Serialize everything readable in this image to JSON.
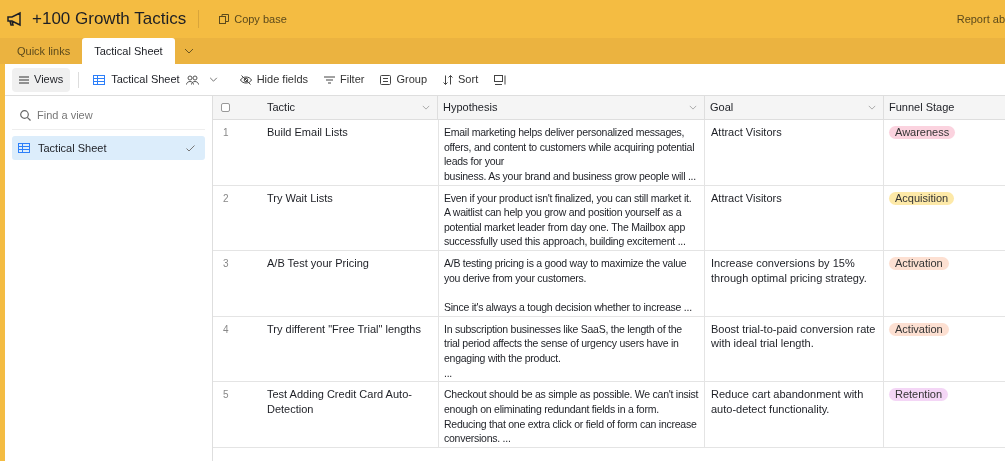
{
  "header": {
    "title": "+100 Growth Tactics",
    "copy_button": "Copy base",
    "report_link": "Report ab"
  },
  "tabs": [
    {
      "label": "Quick links",
      "selected": false
    },
    {
      "label": "Tactical Sheet",
      "selected": true
    }
  ],
  "toolbar": {
    "views_button": "Views",
    "view_name": "Tactical Sheet",
    "buttons": [
      {
        "kind": "hide",
        "label": "Hide fields"
      },
      {
        "kind": "filter",
        "label": "Filter"
      },
      {
        "kind": "group",
        "label": "Group"
      },
      {
        "kind": "sort",
        "label": "Sort"
      },
      {
        "kind": "more"
      }
    ]
  },
  "sidebar": {
    "search": {
      "placeholder": "Find a view"
    },
    "items": [
      {
        "label": "Tactical Sheet",
        "selected": true
      }
    ]
  },
  "table": {
    "select_all": {
      "checked": false
    },
    "columns": [
      "Tactic",
      "Hypothesis",
      "Goal",
      "Funnel Stage"
    ],
    "rows": [
      {
        "number": "1",
        "tactic": "Build Email Lists",
        "hypothesis": "Email marketing helps deliver personalized messages, offers, and content to customers while acquiring potential leads for your\nbusiness. As your brand and business grow people will ...",
        "goal": "Attract Visitors",
        "stage": {
          "label": "Awareness",
          "color": "#fbd3df"
        }
      },
      {
        "number": "2",
        "tactic": "Try Wait Lists",
        "hypothesis": "Even if your product isn't finalized, you can still market it. A waitlist can help you grow and position yourself as a potential market leader from day one. The Mailbox app successfully used this approach, building excitement ...",
        "goal": "Attract Visitors",
        "stage": {
          "label": "Acquisition",
          "color": "#fde9a8"
        }
      },
      {
        "number": "3",
        "tactic": "A/B Test your Pricing",
        "hypothesis": "A/B testing pricing is a good way to maximize the value you derive from your customers.\n\n Since it's always a tough decision whether to increase ...",
        "goal": "Increase conversions by 15% through optimal pricing strategy.",
        "stage": {
          "label": "Activation",
          "color": "#fde0d2"
        }
      },
      {
        "number": "4",
        "tactic": "Try different \"Free Trial\" lengths",
        "hypothesis": "In subscription businesses like SaaS, the length of the trial period affects the sense of urgency users have in engaging with the product.\n...",
        "goal": "Boost trial-to-paid conversion rate with ideal trial length.",
        "stage": {
          "label": "Activation",
          "color": "#fde0d2"
        }
      },
      {
        "number": "5",
        "tactic": "Test Adding Credit Card Auto-Detection",
        "hypothesis": "Checkout should be as simple as possible. We can't insist enough on eliminating redundant fields in a form. Reducing that one extra click or field of form can increase conversions. ...",
        "goal": "Reduce cart abandonment with auto-detect functionality.",
        "stage": {
          "label": "Retention",
          "color": "#f4d6f6"
        }
      }
    ]
  }
}
